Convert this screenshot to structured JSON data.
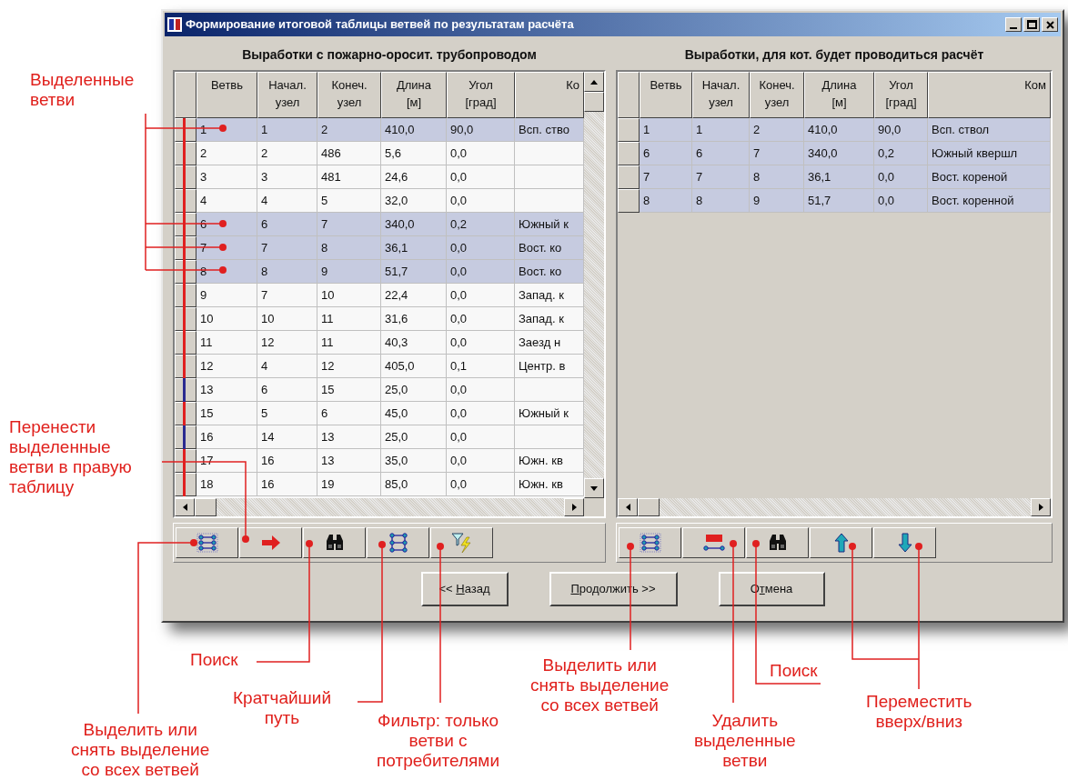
{
  "window": {
    "title": "Формирование итоговой таблицы ветвей по результатам расчёта"
  },
  "left_panel": {
    "heading": "Выработки с пожарно-оросит. трубопроводом",
    "columns": [
      "Ветвь",
      "Начал. узел",
      "Конеч. узел",
      "Длина [м]",
      "Угол [град]",
      "Ко"
    ],
    "rows": [
      {
        "cells": [
          "1",
          "1",
          "2",
          "410,0",
          "90,0",
          "Всп. ство"
        ],
        "selected": true,
        "color": "#e02020"
      },
      {
        "cells": [
          "2",
          "2",
          "486",
          "5,6",
          "0,0",
          ""
        ],
        "selected": false,
        "color": "#e02020"
      },
      {
        "cells": [
          "3",
          "3",
          "481",
          "24,6",
          "0,0",
          ""
        ],
        "selected": false,
        "color": "#e02020"
      },
      {
        "cells": [
          "4",
          "4",
          "5",
          "32,0",
          "0,0",
          ""
        ],
        "selected": false,
        "color": "#e02020"
      },
      {
        "cells": [
          "6",
          "6",
          "7",
          "340,0",
          "0,2",
          "Южный к"
        ],
        "selected": true,
        "color": "#e02020"
      },
      {
        "cells": [
          "7",
          "7",
          "8",
          "36,1",
          "0,0",
          "Вост. ко"
        ],
        "selected": true,
        "color": "#e02020"
      },
      {
        "cells": [
          "8",
          "8",
          "9",
          "51,7",
          "0,0",
          "Вост. ко"
        ],
        "selected": true,
        "color": "#e02020"
      },
      {
        "cells": [
          "9",
          "7",
          "10",
          "22,4",
          "0,0",
          "Запад. к"
        ],
        "selected": false,
        "color": "#e02020"
      },
      {
        "cells": [
          "10",
          "10",
          "11",
          "31,6",
          "0,0",
          "Запад. к"
        ],
        "selected": false,
        "color": "#e02020"
      },
      {
        "cells": [
          "11",
          "12",
          "11",
          "40,3",
          "0,0",
          "Заезд н"
        ],
        "selected": false,
        "color": "#e02020"
      },
      {
        "cells": [
          "12",
          "4",
          "12",
          "405,0",
          "0,1",
          "Центр. в"
        ],
        "selected": false,
        "color": "#e02020"
      },
      {
        "cells": [
          "13",
          "6",
          "15",
          "25,0",
          "0,0",
          ""
        ],
        "selected": false,
        "color": "#2a2a90"
      },
      {
        "cells": [
          "15",
          "5",
          "6",
          "45,0",
          "0,0",
          "Южный к"
        ],
        "selected": false,
        "color": "#e02020"
      },
      {
        "cells": [
          "16",
          "14",
          "13",
          "25,0",
          "0,0",
          ""
        ],
        "selected": false,
        "color": "#2a2a90"
      },
      {
        "cells": [
          "17",
          "16",
          "13",
          "35,0",
          "0,0",
          "Южн. кв"
        ],
        "selected": false,
        "color": "#e02020"
      },
      {
        "cells": [
          "18",
          "16",
          "19",
          "85,0",
          "0,0",
          "Южн. кв"
        ],
        "selected": false,
        "color": "#e02020"
      }
    ]
  },
  "right_panel": {
    "heading": "Выработки, для кот. будет проводиться расчёт",
    "columns": [
      "Ветвь",
      "Начал. узел",
      "Конеч. узел",
      "Длина [м]",
      "Угол [град]",
      "Ком"
    ],
    "rows": [
      {
        "cells": [
          "1",
          "1",
          "2",
          "410,0",
          "90,0",
          "Всп. ствол"
        ],
        "selected": true
      },
      {
        "cells": [
          "6",
          "6",
          "7",
          "340,0",
          "0,2",
          "Южный квершл"
        ],
        "selected": true
      },
      {
        "cells": [
          "7",
          "7",
          "8",
          "36,1",
          "0,0",
          "Вост. кореной"
        ],
        "selected": true
      },
      {
        "cells": [
          "8",
          "8",
          "9",
          "51,7",
          "0,0",
          "Вост. коренной"
        ],
        "selected": true
      }
    ]
  },
  "left_toolbar": [
    {
      "kind": "select-all"
    },
    {
      "kind": "move-right"
    },
    {
      "kind": "search"
    },
    {
      "kind": "shortest-path"
    },
    {
      "kind": "filter"
    }
  ],
  "right_toolbar": [
    {
      "kind": "select-all"
    },
    {
      "kind": "delete"
    },
    {
      "kind": "search"
    },
    {
      "kind": "move-up"
    },
    {
      "kind": "move-down"
    }
  ],
  "buttons": [
    {
      "before": "<< ",
      "accel": "Н",
      "after": "азад"
    },
    {
      "accel": "П",
      "after": "родолжить >>"
    },
    {
      "before": "О",
      "accel": "т",
      "after": "мена"
    }
  ],
  "annotations": [
    {
      "lines": [
        "Выделенные",
        "ветви"
      ]
    },
    {
      "lines": [
        "Перенести",
        "выделенные",
        "ветви в правую",
        "таблицу"
      ]
    },
    {
      "lines": [
        "Поиск"
      ]
    },
    {
      "lines": [
        "Кратчайший",
        "путь"
      ]
    },
    {
      "lines": [
        "Выделить или",
        "снять выделение",
        "со всех ветвей"
      ]
    },
    {
      "lines": [
        "Фильтр: только",
        "ветви с",
        "потребителями"
      ]
    },
    {
      "lines": [
        "Выделить или",
        "снять выделение",
        "со всех ветвей"
      ]
    },
    {
      "lines": [
        "Удалить",
        "выделенные",
        "ветви"
      ]
    },
    {
      "lines": [
        "Поиск"
      ]
    },
    {
      "lines": [
        "Переместить",
        "вверх/вниз"
      ]
    }
  ]
}
